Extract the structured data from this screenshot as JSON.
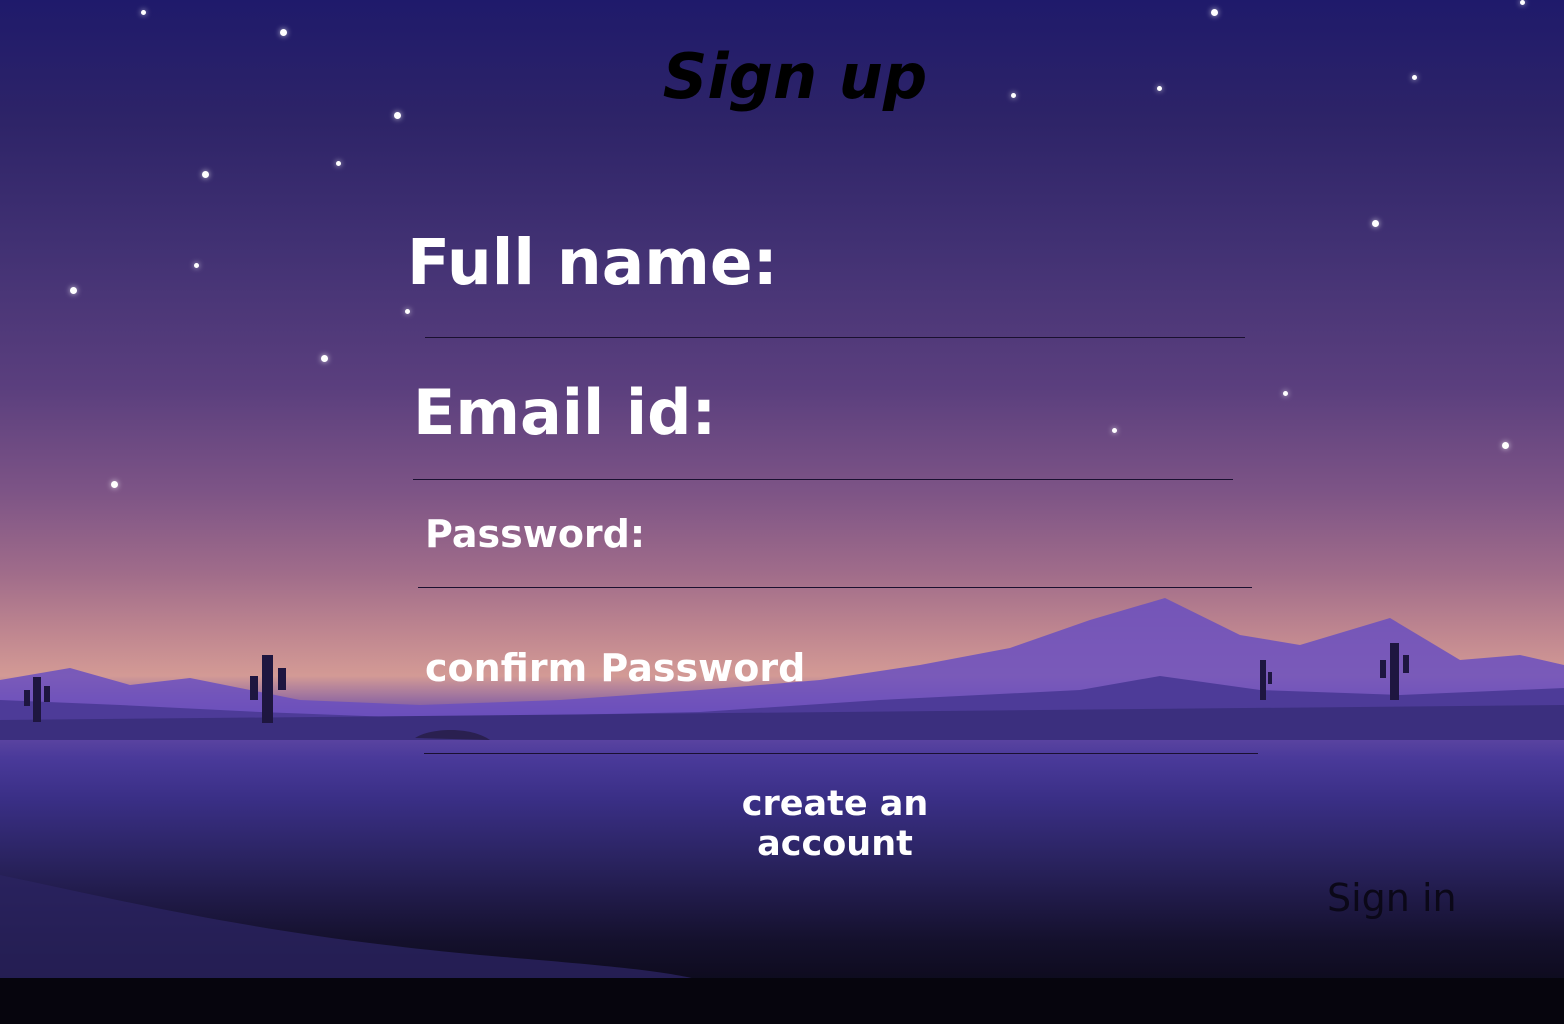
{
  "page": {
    "title": "Sign up"
  },
  "form": {
    "full_name_label": "Full name:",
    "email_label": "Email id:",
    "password_label": "Password:",
    "confirm_password_label": "confirm Password",
    "full_name_value": "",
    "email_value": "",
    "password_value": "",
    "confirm_password_value": "",
    "create_button_label": "create an account"
  },
  "footer": {
    "sign_in_link": "Sign in"
  },
  "colors": {
    "sky_top": "#1f1a6b",
    "sky_horizon": "#d39a95",
    "mountains": "#5a44b0",
    "ground": "#2a2360",
    "label_text": "#ffffff",
    "title_text": "#000000"
  }
}
